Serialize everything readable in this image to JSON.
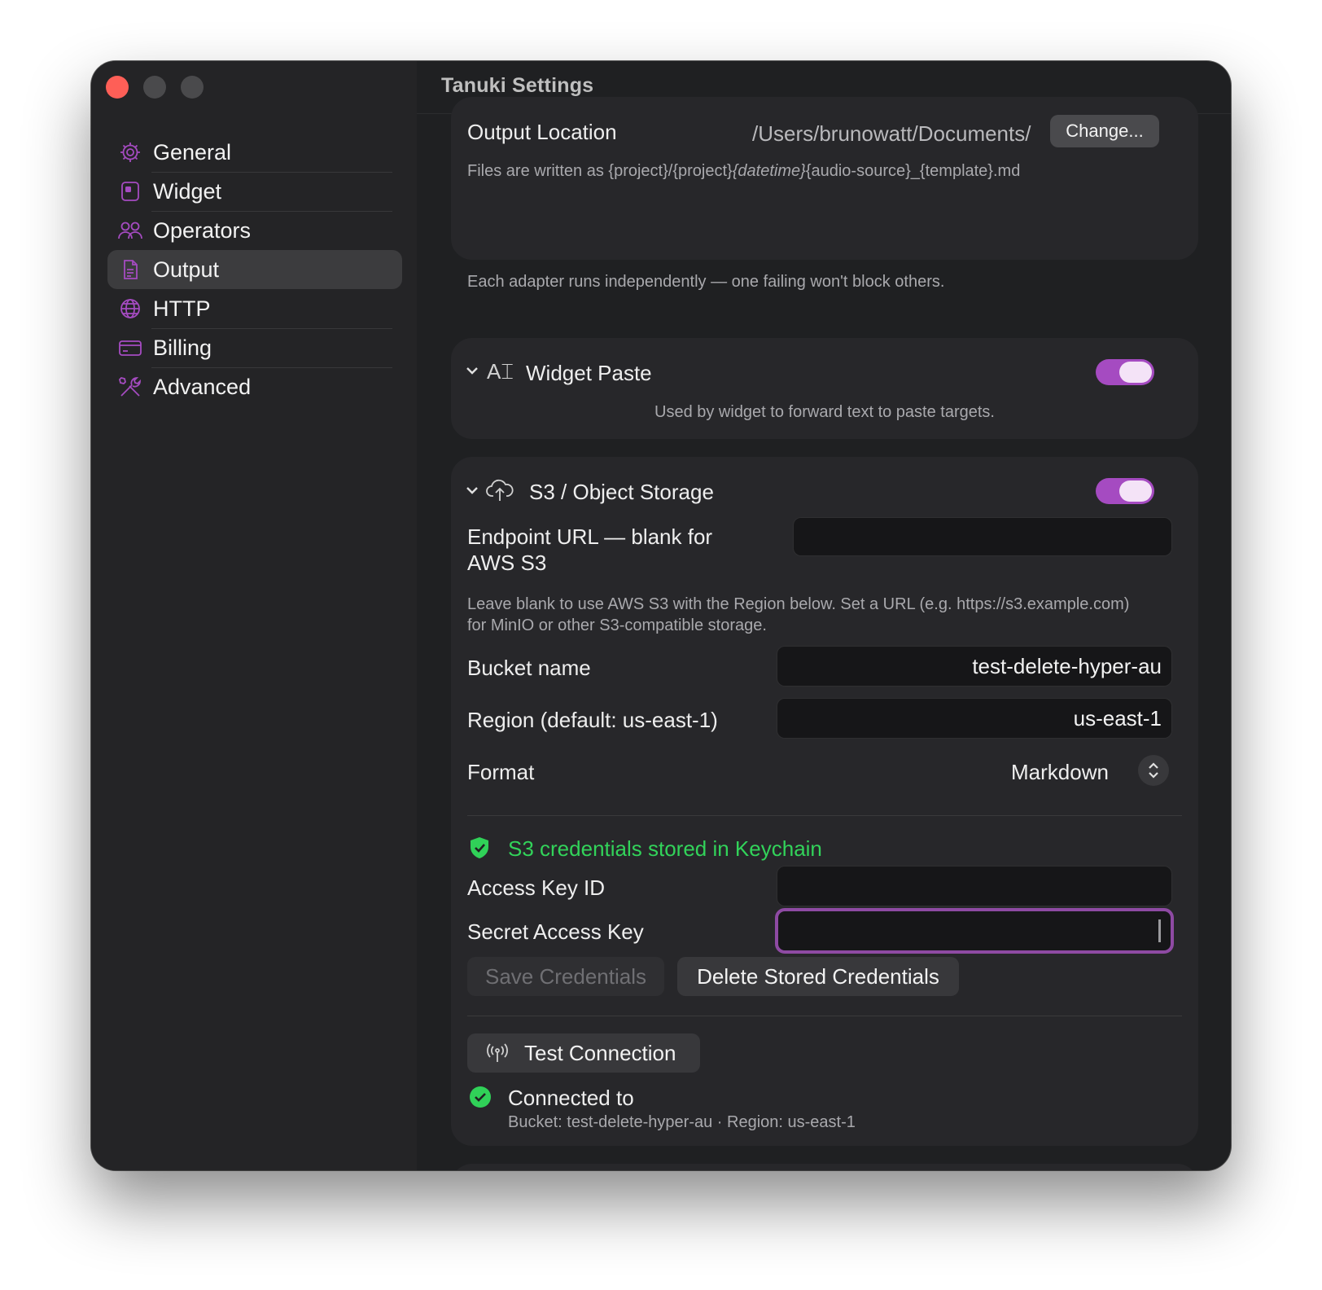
{
  "window": {
    "title": "Tanuki Settings"
  },
  "sidebar": {
    "items": [
      {
        "label": "General",
        "icon": "gear-icon"
      },
      {
        "label": "Widget",
        "icon": "widget-icon"
      },
      {
        "label": "Operators",
        "icon": "people-icon"
      },
      {
        "label": "Output",
        "icon": "document-icon",
        "active": true
      },
      {
        "label": "HTTP",
        "icon": "globe-icon"
      },
      {
        "label": "Billing",
        "icon": "card-icon"
      },
      {
        "label": "Advanced",
        "icon": "tools-icon"
      }
    ]
  },
  "output_location": {
    "label": "Output Location",
    "path": "/Users/brunowatt/Documents/",
    "change_button": "Change...",
    "hint_prefix": "Files are written as {project}/{project}",
    "hint_italic": "{datetime}",
    "hint_suffix": "{audio-source}_{template}.md"
  },
  "adapters_note": "Each adapter runs independently — one failing won't block others.",
  "widget_paste": {
    "title": "Widget Paste",
    "enabled": true,
    "description": "Used by widget to forward text to paste targets."
  },
  "s3": {
    "title": "S3 / Object Storage",
    "enabled": true,
    "endpoint_label_line1": "Endpoint URL — blank for",
    "endpoint_label_line2": "AWS S3",
    "endpoint_value": "",
    "endpoint_help_line1": "Leave blank to use AWS S3 with the Region below. Set a URL (e.g. https://s3.example.com)",
    "endpoint_help_line2": "for MinIO or other S3-compatible storage.",
    "bucket_label": "Bucket name",
    "bucket_value": "test-delete-hyper-au",
    "region_label": "Region (default: us-east-1)",
    "region_value": "us-east-1",
    "format_label": "Format",
    "format_value": "Markdown",
    "credentials_status": "S3 credentials stored in Keychain",
    "access_key_label": "Access Key ID",
    "secret_key_label": "Secret Access Key",
    "save_button": "Save Credentials",
    "delete_button": "Delete Stored Credentials",
    "test_button": "Test Connection",
    "connection_status": "Connected to",
    "connection_detail": "Bucket: test-delete-hyper-au · Region: us-east-1"
  },
  "colors": {
    "accent": "#a54bc1",
    "success": "#30d158",
    "success_text": "#32d35a"
  }
}
